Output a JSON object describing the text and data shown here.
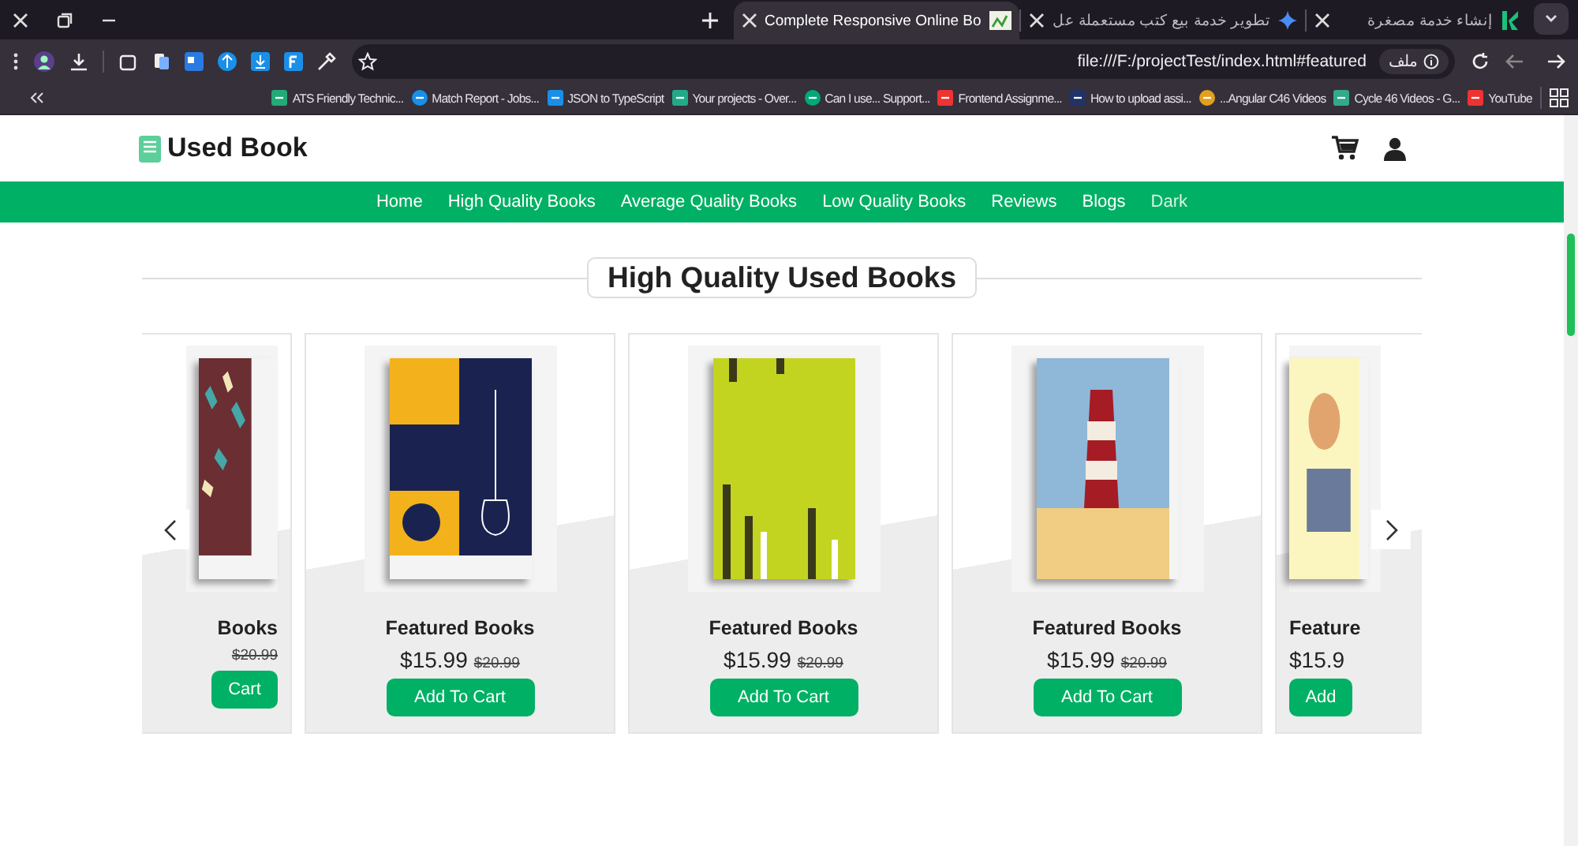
{
  "browser": {
    "tabs": [
      {
        "title": "إنشاء خدمة مصغرة",
        "selected": false
      },
      {
        "title": "تطوير خدمة بيع كتب مستعملة عل",
        "selected": false
      },
      {
        "title": "Complete Responsive Online Bo",
        "selected": true
      }
    ],
    "address_bar": {
      "chip": "ملف",
      "url": "file:///F:/projectTest/index.html#featured"
    },
    "bookmarks": [
      {
        "label": "ATS Friendly Technic..."
      },
      {
        "label": "Match Report - Jobs..."
      },
      {
        "label": "JSON to TypeScript"
      },
      {
        "label": "Your projects - Over..."
      },
      {
        "label": "Can I use... Support..."
      },
      {
        "label": "Frontend Assignme..."
      },
      {
        "label": "How to upload assi..."
      },
      {
        "label": "...Angular C46 Videos"
      },
      {
        "label": "Cycle 46 Videos - G..."
      },
      {
        "label": "YouTube"
      }
    ]
  },
  "page": {
    "logo": "Used Book",
    "nav": [
      {
        "label": "Home",
        "kind": "link"
      },
      {
        "label": "High Quality Books",
        "kind": "link"
      },
      {
        "label": "Average Quality Books",
        "kind": "link"
      },
      {
        "label": "Low Quality Books",
        "kind": "link"
      },
      {
        "label": "Reviews",
        "kind": "link"
      },
      {
        "label": "Blogs",
        "kind": "link"
      },
      {
        "label": "Dark",
        "kind": "toggle"
      }
    ],
    "section_title": "High Quality Used Books",
    "products": [
      {
        "kind": "cut-left",
        "title": "Books",
        "old_price": "$20.99",
        "button": "Cart"
      },
      {
        "kind": "full",
        "title": "Featured Books",
        "price": "$15.99",
        "old_price": "$20.99",
        "button": "Add To Cart"
      },
      {
        "kind": "full",
        "title": "Featured Books",
        "price": "$15.99",
        "old_price": "$20.99",
        "button": "Add To Cart"
      },
      {
        "kind": "full",
        "title": "Featured Books",
        "price": "$15.99",
        "old_price": "$20.99",
        "button": "Add To Cart"
      },
      {
        "kind": "cut-right",
        "title": "Feature",
        "price": "$15.9",
        "button": "Add"
      }
    ]
  }
}
